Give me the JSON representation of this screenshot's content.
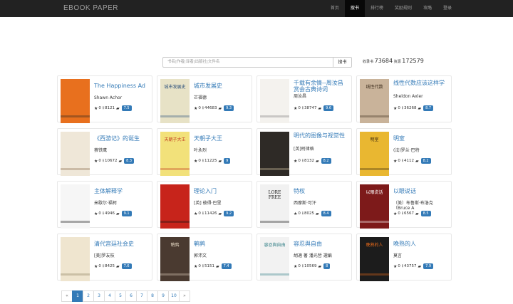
{
  "brand": "EBOOK   PAPER",
  "nav": [
    {
      "label": "首页",
      "name": "nav-home",
      "active": false
    },
    {
      "label": "搜书",
      "name": "nav-search-books",
      "active": true
    },
    {
      "label": "排行榜",
      "name": "nav-rankings",
      "active": false
    },
    {
      "label": "奖励规则",
      "name": "nav-reward-rules",
      "active": false
    },
    {
      "label": "攻略",
      "name": "nav-guide",
      "active": false
    },
    {
      "label": "登录",
      "name": "nav-login",
      "active": false
    }
  ],
  "search": {
    "placeholder": "书名|作者|译者|出版社|文件名",
    "button": "搜书"
  },
  "stats": {
    "collected_label": "收录书",
    "collected_value": "73684",
    "resources_label": "资源",
    "resources_value": "172579"
  },
  "books": [
    {
      "title": "The Happiness Ad",
      "author": "Shawn Achor",
      "stars": "0",
      "downloads": "8121",
      "comments": "",
      "rating": "7.5",
      "cover": {
        "bg": "#e8701e",
        "fg": "#222",
        "text": ""
      }
    },
    {
      "title": "城市发展史",
      "author": "芒福德",
      "stars": "0",
      "downloads": "44683",
      "comments": "",
      "rating": "9.3",
      "cover": {
        "bg": "#e7e2c6",
        "fg": "#2b4f7b",
        "text": "城市发展史"
      }
    },
    {
      "title": "千载有余情--周汝昌赏会古典诗词",
      "author": "周汝昌",
      "stars": "0",
      "downloads": "38747",
      "comments": "",
      "rating": "9.6",
      "cover": {
        "bg": "#f4f2ee",
        "fg": "#777",
        "text": ""
      }
    },
    {
      "title": "线性代数应该这样学",
      "author": "Sheldon Axler",
      "stars": "0",
      "downloads": "36268",
      "comments": "",
      "rating": "8.7",
      "cover": {
        "bg": "#c9b39a",
        "fg": "#3a2a1a",
        "text": "线性代数"
      }
    },
    {
      "title": "《西游记》的诞生",
      "author": "蔡铁鹰",
      "stars": "0",
      "downloads": "10672",
      "comments": "",
      "rating": "8.3",
      "cover": {
        "bg": "#efe7d8",
        "fg": "#8a6a4a",
        "text": ""
      }
    },
    {
      "title": "天朝子大王",
      "author": "叶永烈",
      "stars": "0",
      "downloads": "11225",
      "comments": "",
      "rating": "9",
      "cover": {
        "bg": "#f2e17a",
        "fg": "#c23b22",
        "text": "天朝子大王"
      }
    },
    {
      "title": "明代的图像与视觉性",
      "author": "[英]柯律格",
      "stars": "0",
      "downloads": "8132",
      "comments": "",
      "rating": "8.2",
      "cover": {
        "bg": "#2e2a26",
        "fg": "#d7c9a7",
        "text": ""
      }
    },
    {
      "title": "明室",
      "author": "(法)罗兰·巴特",
      "stars": "0",
      "downloads": "4112",
      "comments": "",
      "rating": "8.2",
      "cover": {
        "bg": "#e9b731",
        "fg": "#3b2a12",
        "text": "明室"
      }
    },
    {
      "title": "主体解释学",
      "author": "米歇尔·福柯",
      "stars": "0",
      "downloads": "4946",
      "comments": "",
      "rating": "9.1",
      "cover": {
        "bg": "#f6f6f6",
        "fg": "#111",
        "text": ""
      }
    },
    {
      "title": "理论入门",
      "author": "[英] 彼得·巴里",
      "stars": "0",
      "downloads": "11426",
      "comments": "",
      "rating": "9.2",
      "cover": {
        "bg": "#c7241b",
        "fg": "#111",
        "text": ""
      }
    },
    {
      "title": "特权",
      "author": "西摩斯·可汗",
      "stars": "0",
      "downloads": "8025",
      "comments": "",
      "rating": "8.4",
      "cover": {
        "bg": "#f1f1f1",
        "fg": "#111",
        "text": "LORE FREE"
      }
    },
    {
      "title": "以眼说话",
      "author": "（美）布鲁斯·布洛克（Bruce A",
      "stars": "0",
      "downloads": "6567",
      "comments": "",
      "rating": "8.5",
      "cover": {
        "bg": "#7d1a1a",
        "fg": "#fff",
        "text": "以眼说话"
      }
    },
    {
      "title": "清代宫廷社会史",
      "author": "[美]罗友枝",
      "stars": "0",
      "downloads": "8425",
      "comments": "",
      "rating": "7.6",
      "cover": {
        "bg": "#efe5cf",
        "fg": "#8a7a5a",
        "text": ""
      }
    },
    {
      "title": "鹌鹑",
      "author": "郭沛文",
      "stars": "0",
      "downloads": "5151",
      "comments": "",
      "rating": "7.4",
      "cover": {
        "bg": "#4a3a30",
        "fg": "#e2d5c0",
        "text": "鹌鹑"
      }
    },
    {
      "title": "容忍與自由",
      "author": "胡適 著 潘光哲 選編",
      "stars": "0",
      "downloads": "10569",
      "comments": "",
      "rating": "8",
      "cover": {
        "bg": "#f2f2f2",
        "fg": "#2c7c83",
        "text": "容忍與自由"
      }
    },
    {
      "title": "晚熟的人",
      "author": "莫言",
      "stars": "0",
      "downloads": "43757",
      "comments": "",
      "rating": "7.9",
      "cover": {
        "bg": "#1c1c1c",
        "fg": "#e86a1a",
        "text": "晚熟的人"
      }
    }
  ],
  "pagination": {
    "prev": "«",
    "pages": [
      "1",
      "2",
      "3",
      "4",
      "5",
      "6",
      "7",
      "8",
      "9",
      "10"
    ],
    "active": "1",
    "next": "»"
  }
}
